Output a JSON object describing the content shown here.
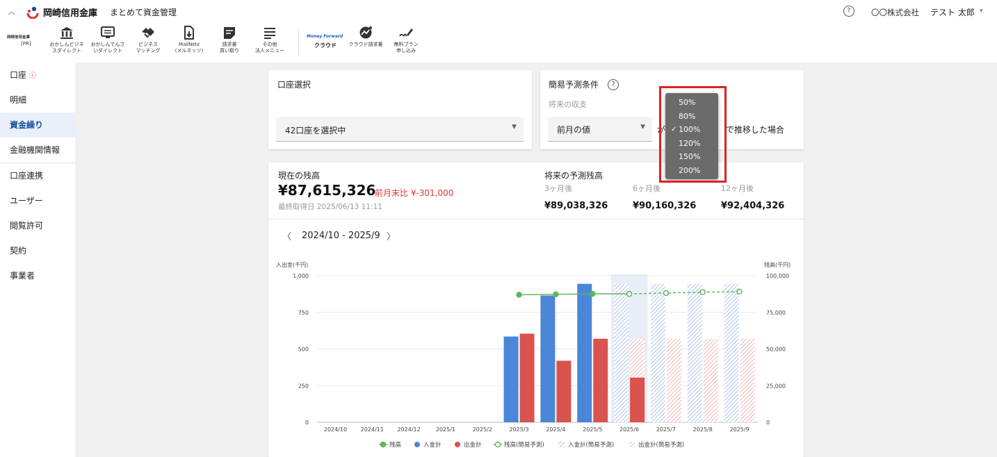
{
  "header": {
    "collapse_icon": "chevron-up-icon",
    "bank_name": "岡崎信用金庫",
    "app_title": "まとめて資金管理",
    "help_icon": "help-circle-icon",
    "help_glyph": "?",
    "company": "〇〇株式会社",
    "user": "テスト 太郎",
    "user_caret": "▾"
  },
  "toolbar": {
    "pr_logo": "岡崎信用金庫",
    "pr_label": "[PR]",
    "items": [
      {
        "icon": "bank-icon",
        "label": "おかしんビジネ\nスダイレクト"
      },
      {
        "icon": "monitor-icon",
        "label": "おかしんでんさ\nいダイレクト"
      },
      {
        "icon": "handshake-icon",
        "label": "ビジネス\nマッチング"
      },
      {
        "icon": "document-download-icon",
        "label": "MailNetz\n(メルネッツ)"
      },
      {
        "icon": "invoice-icon",
        "label": "請求書\n買い取り"
      },
      {
        "icon": "menu-icon",
        "label": "その他\n法人メニュー"
      }
    ],
    "mf_logo": "Money Forward",
    "mf_label": "クラウド",
    "mf_items": [
      {
        "icon": "mf-invoice-icon",
        "label": "クラウド請求書"
      },
      {
        "icon": "signature-icon",
        "label": "無料プラン\n申し込み"
      }
    ]
  },
  "sidebar": {
    "items": [
      {
        "label": "口座",
        "warn": "ⓘ"
      },
      {
        "label": "明細"
      },
      {
        "label": "資金繰り",
        "active": true
      },
      {
        "label": "金融機関情報"
      },
      {
        "label": "口座連携"
      },
      {
        "label": "ユーザー"
      },
      {
        "label": "閲覧許可"
      },
      {
        "label": "契約"
      },
      {
        "label": "事業者"
      }
    ]
  },
  "account_card": {
    "title": "口座選択",
    "select_value": "42口座を選択中",
    "caret": "▼"
  },
  "forecast_card": {
    "title": "簡易予測条件",
    "help_glyph": "?",
    "sub_label": "将来の収支",
    "select_value": "前月の値",
    "caret": "▼",
    "partial_text": "が",
    "suffix_text": "で推移した場合"
  },
  "dropdown": {
    "options": [
      "50%",
      "80%",
      "100%",
      "120%",
      "150%",
      "200%"
    ],
    "selected_index": 2,
    "check": "✓"
  },
  "balance": {
    "current_label": "現在の残高",
    "current_value": "¥87,615,326",
    "diff_text": "前月末比 ¥-301,000",
    "fetched_at": "最終取得日 2025/06/13 11:11",
    "forecast_label": "将来の予測残高",
    "forecasts": [
      {
        "label": "3ヶ月後",
        "value": "¥89,038,326"
      },
      {
        "label": "6ヶ月後",
        "value": "¥90,160,326"
      },
      {
        "label": "12ヶ月後",
        "value": "¥92,404,326"
      }
    ]
  },
  "period": {
    "prev_icon": "chevron-left-icon",
    "next_icon": "chevron-right-icon",
    "prev_glyph": "〈",
    "next_glyph": "〉",
    "label": "2024/10 - 2025/9"
  },
  "chart_data": {
    "type": "bar",
    "left_axis_label": "入出金(千円)",
    "right_axis_label": "残高(千円)",
    "ylim_left": [
      0,
      1000
    ],
    "ylim_right": [
      0,
      100000
    ],
    "left_ticks": [
      "1,000",
      "750",
      "500",
      "250",
      "0"
    ],
    "right_ticks": [
      "100,000",
      "75,000",
      "50,000",
      "25,000",
      "0"
    ],
    "categories": [
      "2024/10",
      "2024/11",
      "2024/12",
      "2025/1",
      "2025/2",
      "2025/3",
      "2025/4",
      "2025/5",
      "2025/6",
      "2025/7",
      "2025/8",
      "2025/9"
    ],
    "highlight_category": "2025/6",
    "series": [
      {
        "name": "入金計",
        "color": "#4a87d8",
        "values": [
          null,
          null,
          null,
          null,
          null,
          585,
          865,
          945,
          null,
          null,
          null,
          null
        ]
      },
      {
        "name": "出金計",
        "color": "#d9534f",
        "values": [
          null,
          null,
          null,
          null,
          null,
          605,
          420,
          570,
          305,
          null,
          null,
          null
        ]
      },
      {
        "name": "入金計(簡易予測)",
        "color": "#9db8e6",
        "values": [
          null,
          null,
          null,
          null,
          null,
          null,
          null,
          null,
          945,
          945,
          945,
          945
        ]
      },
      {
        "name": "出金計(簡易予測)",
        "color": "#eba6a3",
        "values": [
          null,
          null,
          null,
          null,
          null,
          null,
          null,
          null,
          570,
          570,
          570,
          570
        ]
      },
      {
        "name": "残高",
        "color": "#5cb85c",
        "axis": "right",
        "values": [
          null,
          null,
          null,
          null,
          null,
          87000,
          87300,
          87600,
          87600,
          null,
          null,
          null
        ]
      },
      {
        "name": "残高(簡易予測)",
        "color": "#5cb85c",
        "axis": "right",
        "values": [
          null,
          null,
          null,
          null,
          null,
          null,
          null,
          null,
          87600,
          88200,
          88800,
          89100
        ]
      }
    ],
    "legend_position": "bottom",
    "legend": [
      {
        "name": "残高",
        "marker": "line-dot"
      },
      {
        "name": "入金計",
        "marker": "dot"
      },
      {
        "name": "出金計",
        "marker": "dot"
      },
      {
        "name": "残高(簡易予測)",
        "marker": "line-ring"
      },
      {
        "name": "入金計(簡易予測)",
        "marker": "hatch"
      },
      {
        "name": "出金計(簡易予測)",
        "marker": "hatch"
      }
    ]
  }
}
